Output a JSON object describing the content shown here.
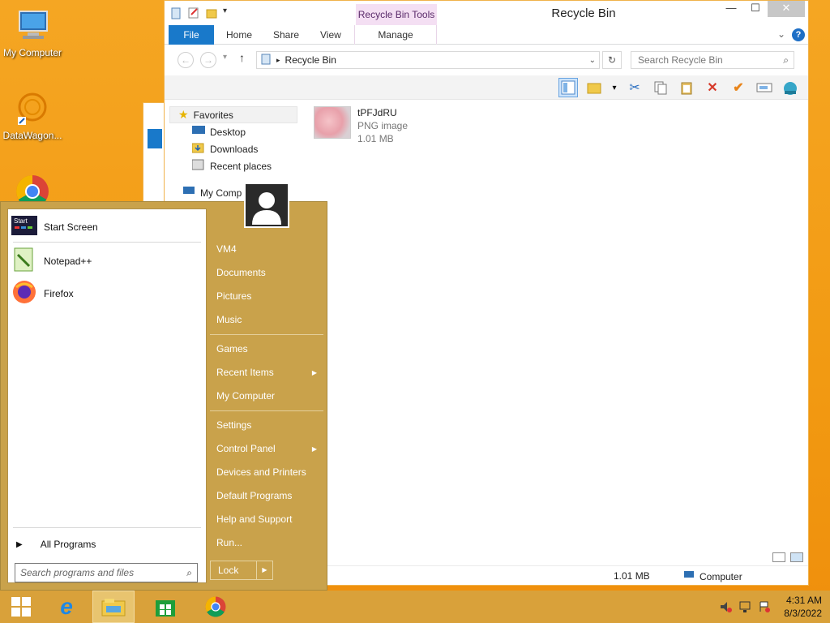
{
  "desktop": {
    "icons": [
      {
        "label": "My Computer"
      },
      {
        "label": "DataWagon..."
      },
      {
        "label": ""
      }
    ]
  },
  "explorer": {
    "title": "Recycle Bin",
    "context_tab": "Recycle Bin Tools",
    "tabs": {
      "file": "File",
      "home": "Home",
      "share": "Share",
      "view": "View",
      "manage": "Manage"
    },
    "address": "Recycle Bin",
    "search_placeholder": "Search Recycle Bin",
    "nav": {
      "favorites": "Favorites",
      "desktop": "Desktop",
      "downloads": "Downloads",
      "recent": "Recent places",
      "mycomputer": "My Comp"
    },
    "file": {
      "name": "tPFJdRU",
      "type": "PNG image",
      "size": "1.01 MB"
    },
    "status": {
      "size": "1.01 MB",
      "location": "Computer"
    }
  },
  "start_menu": {
    "pinned": [
      {
        "label": "Start Screen"
      },
      {
        "label": "Notepad++"
      },
      {
        "label": "Firefox"
      }
    ],
    "all_programs": "All Programs",
    "search_placeholder": "Search programs and files",
    "links_group1": [
      "VM4",
      "Documents",
      "Pictures",
      "Music"
    ],
    "links_group2": [
      "Games",
      "Recent Items",
      "My Computer"
    ],
    "links_group3": [
      "Settings",
      "Control Panel",
      "Devices and Printers",
      "Default Programs",
      "Help and Support",
      "Run..."
    ],
    "lock": "Lock"
  },
  "taskbar": {
    "time": "4:31 AM",
    "date": "8/3/2022"
  }
}
